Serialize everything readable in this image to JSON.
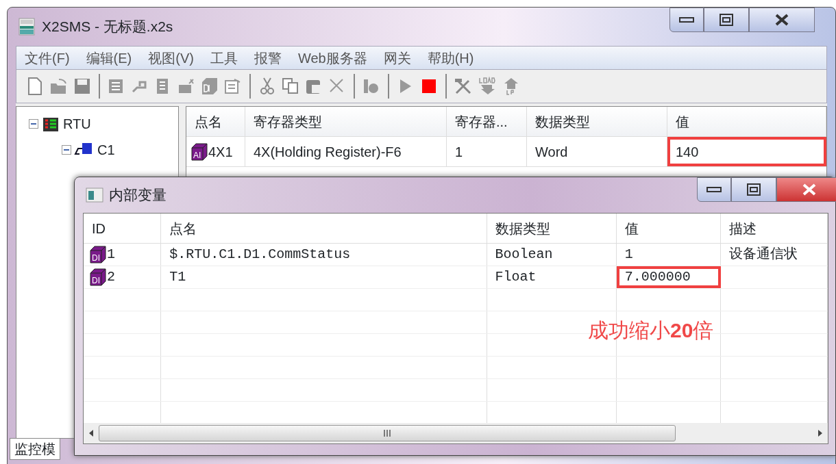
{
  "window": {
    "title": "X2SMS - 无标题.x2s"
  },
  "menu": [
    "文件(F)",
    "编辑(E)",
    "视图(V)",
    "工具",
    "报警",
    "Web服务器",
    "网关",
    "帮助(H)"
  ],
  "tree": [
    {
      "label": "RTU",
      "kind": "rtu",
      "expanded": true,
      "children": [
        {
          "label": "C1",
          "kind": "channel",
          "expanded": true
        }
      ]
    }
  ],
  "points_table": {
    "columns": [
      "点名",
      "寄存器类型",
      "寄存器...",
      "数据类型",
      "值"
    ],
    "rows": [
      {
        "cells": [
          {
            "text": "4X1",
            "highlighted": false
          },
          {
            "text": "4X(Holding Register)-F6",
            "highlighted": false
          },
          {
            "text": "1",
            "highlighted": false
          },
          {
            "text": "Word",
            "highlighted": false
          },
          {
            "text": "140",
            "highlighted": true
          }
        ],
        "icon": "AI"
      }
    ]
  },
  "status_tab": "监控模",
  "child_window": {
    "title": "内部变量",
    "columns": [
      "ID",
      "点名",
      "数据类型",
      "值",
      "描述"
    ],
    "rows": [
      {
        "cells": [
          {
            "text": "1",
            "highlighted": false
          },
          {
            "text": "$.RTU.C1.D1.CommStatus",
            "highlighted": false
          },
          {
            "text": "Boolean",
            "highlighted": false
          },
          {
            "text": "1",
            "highlighted": false
          },
          {
            "text": "设备通信状",
            "highlighted": false
          }
        ],
        "icon": "DI"
      },
      {
        "cells": [
          {
            "text": "2",
            "highlighted": false
          },
          {
            "text": "T1",
            "highlighted": false
          },
          {
            "text": "Float",
            "highlighted": false
          },
          {
            "text": "7.000000",
            "highlighted": true
          }
        ],
        "icon": "DI"
      }
    ],
    "annotation": "成功缩小**20**倍"
  }
}
